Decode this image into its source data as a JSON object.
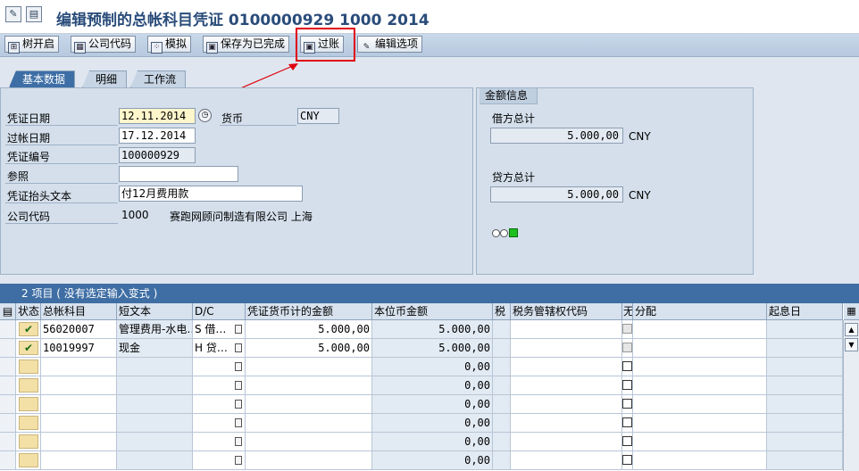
{
  "window": {
    "title": "编辑预制的总帐科目凭证 0100000929 1000 2014"
  },
  "toolbar": {
    "buttons": [
      {
        "label": "树开启",
        "icon": "tree-icon"
      },
      {
        "label": "公司代码",
        "icon": "company-icon"
      },
      {
        "label": "模拟",
        "icon": "simulate-icon"
      },
      {
        "label": "保存为已完成",
        "icon": "save-icon"
      },
      {
        "label": "过账",
        "icon": "save-icon"
      },
      {
        "label": "编辑选项",
        "icon": "pencil-icon"
      }
    ],
    "highlighted": "过账",
    "highlight_color": "#e0000e"
  },
  "tabs": [
    {
      "label": "基本数据",
      "active": true
    },
    {
      "label": "明细",
      "active": false
    },
    {
      "label": "工作流",
      "active": false
    }
  ],
  "basic": {
    "doc_date_label": "凭证日期",
    "doc_date": "12.11.2014",
    "currency_label": "货币",
    "currency": "CNY",
    "post_date_label": "过帐日期",
    "post_date": "17.12.2014",
    "doc_no_label": "凭证编号",
    "doc_no": "100000929",
    "ref_label": "参照",
    "ref": "",
    "header_text_label": "凭证抬头文本",
    "header_text": "付12月费用款",
    "company_label": "公司代码",
    "company_code": "1000",
    "company_name": "赛跑网顾问制造有限公司 上海"
  },
  "amount_info": {
    "title": "金额信息",
    "debit_label": "借方总计",
    "debit_value": "5.000,00",
    "debit_currency": "CNY",
    "credit_label": "贷方总计",
    "credit_value": "5.000,00",
    "credit_currency": "CNY",
    "status_light": "green"
  },
  "grid": {
    "title": "2 项目 ( 没有选定输入变式 )",
    "headers": [
      "状态",
      "总帐科目",
      "短文本",
      "D/C",
      "凭证货币计的金额",
      "本位币金额",
      "税",
      "税务管辖权代码",
      "无",
      "分配",
      "起息日"
    ],
    "rows": [
      {
        "account": "56020007",
        "text": "管理费用-水电…",
        "dc": "S 借…",
        "amount": "5.000,00",
        "local": "5.000,00"
      },
      {
        "account": "10019997",
        "text": "现金",
        "dc": "H 贷…",
        "amount": "5.000,00",
        "local": "5.000,00"
      },
      {
        "account": "",
        "text": "",
        "dc": "",
        "amount": "",
        "local": "0,00"
      },
      {
        "account": "",
        "text": "",
        "dc": "",
        "amount": "",
        "local": "0,00"
      },
      {
        "account": "",
        "text": "",
        "dc": "",
        "amount": "",
        "local": "0,00"
      },
      {
        "account": "",
        "text": "",
        "dc": "",
        "amount": "",
        "local": "0,00"
      },
      {
        "account": "",
        "text": "",
        "dc": "",
        "amount": "",
        "local": "0,00"
      },
      {
        "account": "",
        "text": "",
        "dc": "",
        "amount": "",
        "local": "0,00"
      }
    ]
  }
}
